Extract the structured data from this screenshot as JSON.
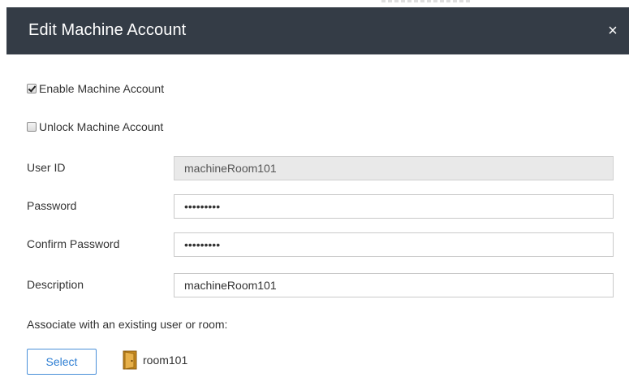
{
  "dialog": {
    "title": "Edit Machine Account",
    "close_glyph": "×",
    "close_icon": "close-icon"
  },
  "enable_account": {
    "label": "Enable Machine Account",
    "checked": true
  },
  "unlock_account": {
    "label": "Unlock Machine Account",
    "checked": false
  },
  "fields": {
    "user_id": {
      "label": "User ID",
      "value": "machineRoom101"
    },
    "password": {
      "label": "Password",
      "value": "•••••••••"
    },
    "confirm_password": {
      "label": "Confirm Password",
      "value": "•••••••••"
    },
    "description": {
      "label": "Description",
      "value": "machineRoom101"
    }
  },
  "association": {
    "hint": "Associate with an existing user or room:",
    "select_label": "Select",
    "room_name": "room101",
    "room_icon": "door-icon"
  },
  "colors": {
    "header_bg": "#343c46",
    "accent": "#2f7fd3",
    "readonly_bg": "#e9e9e9"
  }
}
